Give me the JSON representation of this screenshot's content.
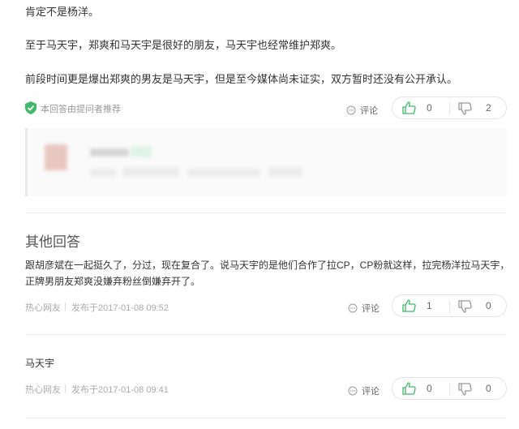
{
  "answer": {
    "line1": "肯定不是杨洋。",
    "line2": "至于马天宇，郑爽和马天宇是很好的朋友，马天宇也经常维护郑爽。",
    "line3": "前段时间更是爆出郑爽的男友是马天宇，但是至今媒体尚未证实，双方暂时还没有公开承认。",
    "recommend_label": "本回答由提问者推荐",
    "comment_label": "评论",
    "up_count": "0",
    "down_count": "2"
  },
  "other_answers_title": "其他回答",
  "other_answers": [
    {
      "text_line1": "跟胡彦斌在一起挺久了，分过，现在复合了。说马天宇的是他们合作了拉CP，CP粉就这样，拉完杨洋拉马天宇，",
      "text_line2": "正牌男朋友郑爽没嫌弃粉丝倒嫌弃开了。",
      "author": "热心网友",
      "published": "发布于2017-01-08 09:52",
      "comment_label": "评论",
      "up_count": "1",
      "down_count": "0"
    },
    {
      "text_line1": "马天宇",
      "author": "热心网友",
      "published": "发布于2017-01-08 09:41",
      "comment_label": "评论",
      "up_count": "0",
      "down_count": "0"
    }
  ],
  "colors": {
    "accent_green": "#3fba6a",
    "muted": "#aaaaaa",
    "border": "#e4e4e4"
  },
  "icons": [
    "shield-check-icon",
    "comment-icon",
    "thumbs-up-icon",
    "thumbs-down-icon"
  ]
}
